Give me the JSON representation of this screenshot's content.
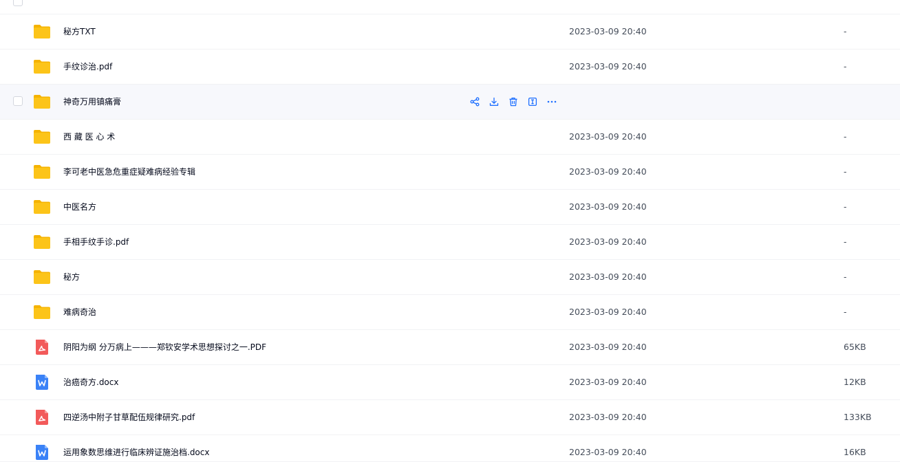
{
  "rows": [
    {
      "name": "",
      "time": "",
      "size": "",
      "type": "folder"
    },
    {
      "name": "秘方TXT",
      "time": "2023-03-09 20:40",
      "size": "-",
      "type": "folder"
    },
    {
      "name": "手纹诊治.pdf",
      "time": "2023-03-09 20:40",
      "size": "-",
      "type": "folder"
    },
    {
      "name": "神奇万用镇痛膏",
      "time": "",
      "size": "",
      "type": "folder"
    },
    {
      "name": "西 藏 医 心 术",
      "time": "2023-03-09 20:40",
      "size": "-",
      "type": "folder"
    },
    {
      "name": "李可老中医急危重症疑难病经验专辑",
      "time": "2023-03-09 20:40",
      "size": "-",
      "type": "folder"
    },
    {
      "name": "中医名方",
      "time": "2023-03-09 20:40",
      "size": "-",
      "type": "folder"
    },
    {
      "name": "手相手纹手诊.pdf",
      "time": "2023-03-09 20:40",
      "size": "-",
      "type": "folder"
    },
    {
      "name": "秘方",
      "time": "2023-03-09 20:40",
      "size": "-",
      "type": "folder"
    },
    {
      "name": "难病奇治",
      "time": "2023-03-09 20:40",
      "size": "-",
      "type": "folder"
    },
    {
      "name": "阴阳为纲 分万病上———郑钦安学术思想探讨之一.PDF",
      "time": "2023-03-09 20:40",
      "size": "65KB",
      "type": "pdf"
    },
    {
      "name": "治癌奇方.docx",
      "time": "2023-03-09 20:40",
      "size": "12KB",
      "type": "word"
    },
    {
      "name": "四逆汤中附子甘草配伍规律研究.pdf",
      "time": "2023-03-09 20:40",
      "size": "133KB",
      "type": "pdf"
    },
    {
      "name": "运用象数思维进行临床辨证施治档.docx",
      "time": "2023-03-09 20:40",
      "size": "16KB",
      "type": "word"
    }
  ],
  "colors": {
    "folder": "#fcc419",
    "folder_dark": "#f5b300",
    "pdf": "#f25a5a",
    "word": "#3a82f7",
    "action": "#1e6fff",
    "hover_bg": "#f7f8fc"
  },
  "icons": {
    "folder": "folder-icon",
    "pdf": "pdf-file-icon",
    "word": "word-file-icon",
    "share": "share-icon",
    "download": "download-icon",
    "delete": "trash-icon",
    "rename": "rename-icon",
    "more": "more-icon"
  }
}
